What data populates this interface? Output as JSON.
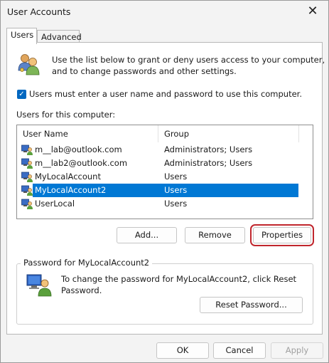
{
  "window": {
    "title": "User Accounts",
    "close_glyph": "✕"
  },
  "tabs": [
    {
      "label": "Users",
      "active": true
    },
    {
      "label": "Advanced",
      "active": false
    }
  ],
  "intro": {
    "text_line1": "Use the list below to grant or deny users access to your computer,",
    "text_line2": "and to change passwords and other settings.",
    "icon": "users-group-icon"
  },
  "checkbox": {
    "label": "Users must enter a user name and password to use this computer.",
    "checked": true
  },
  "users_list": {
    "caption": "Users for this computer:",
    "columns": [
      "User Name",
      "Group"
    ],
    "rows": [
      {
        "name": "m__lab@outlook.com",
        "group": "Administrators; Users",
        "selected": false
      },
      {
        "name": "m__lab2@outlook.com",
        "group": "Administrators; Users",
        "selected": false
      },
      {
        "name": "MyLocalAccount",
        "group": "Users",
        "selected": false
      },
      {
        "name": "MyLocalAccount2",
        "group": "Users",
        "selected": true
      },
      {
        "name": "UserLocal",
        "group": "Users",
        "selected": false
      }
    ]
  },
  "list_buttons": {
    "add": "Add...",
    "remove": "Remove",
    "properties": "Properties"
  },
  "password_group": {
    "title": "Password for MyLocalAccount2",
    "text_line1": "To change the password for MyLocalAccount2, click Reset",
    "text_line2": "Password.",
    "reset_button": "Reset Password..."
  },
  "footer": {
    "ok": "OK",
    "cancel": "Cancel",
    "apply": "Apply"
  },
  "colors": {
    "selection": "#0078d4",
    "checkbox": "#0067c0",
    "highlight_frame": "#c0262d"
  }
}
